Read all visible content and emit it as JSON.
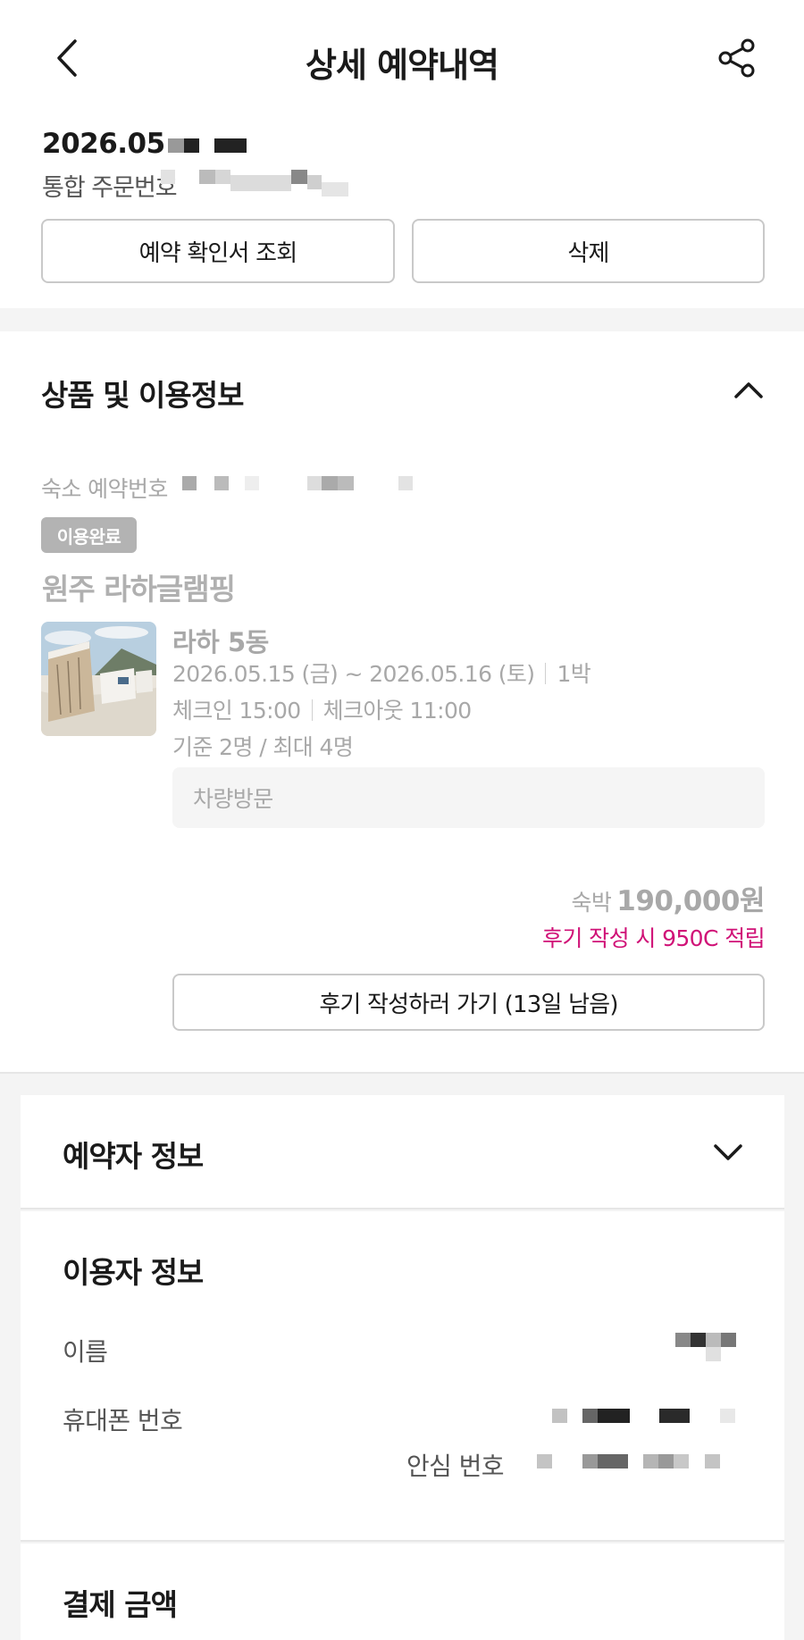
{
  "header": {
    "title": "상세 예약내역",
    "back_icon": "chevron-left-icon",
    "share_icon": "share-icon"
  },
  "order": {
    "date": "2026.05",
    "number_label": "통합 주문번호"
  },
  "actions": {
    "confirm_label": "예약 확인서 조회",
    "delete_label": "삭제"
  },
  "product_section": {
    "title": "상품 및 이용정보",
    "reservation_number_label": "숙소 예약번호",
    "status_badge": "이용완료",
    "hotel_name": "원주 라하글램핑",
    "room_name": "라하 5동",
    "dates": "2026.05.15 (금) ~ 2026.05.16 (토)",
    "nights": "1박",
    "checkin": "체크인 15:00",
    "checkout": "체크아웃 11:00",
    "occupancy": "기준 2명 / 최대 4명",
    "vehicle": "차량방문",
    "price_label": "숙박",
    "price": "190,000원",
    "reward": "후기 작성 시 950C 적립",
    "review_button": "후기 작성하러 가기 (13일 남음)"
  },
  "booker_info": {
    "title": "예약자 정보"
  },
  "user_info": {
    "title": "이용자 정보",
    "name_label": "이름",
    "phone_label": "휴대폰 번호",
    "safe_number_label": "안심 번호"
  },
  "payment": {
    "title": "결제 금액"
  },
  "colors": {
    "reward": "#d01277",
    "badge": "#b3b3b3",
    "muted_text": "#a8a8a8",
    "background_band": "#f4f4f4"
  }
}
